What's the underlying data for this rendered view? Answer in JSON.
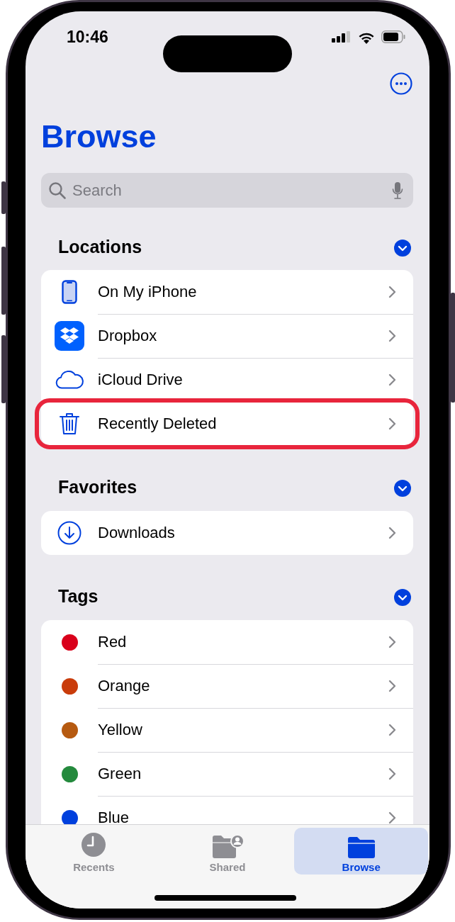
{
  "status_bar": {
    "time": "10:46"
  },
  "title": "Browse",
  "search": {
    "placeholder": "Search"
  },
  "sections": [
    {
      "title": "Locations",
      "expanded": true,
      "items": [
        {
          "kind": "phone",
          "label": "On My iPhone",
          "highlighted": false
        },
        {
          "kind": "dropbox",
          "label": "Dropbox",
          "highlighted": false
        },
        {
          "kind": "cloud",
          "label": "iCloud Drive",
          "highlighted": false
        },
        {
          "kind": "trash",
          "label": "Recently Deleted",
          "highlighted": true
        }
      ]
    },
    {
      "title": "Favorites",
      "expanded": true,
      "items": [
        {
          "kind": "download",
          "label": "Downloads",
          "highlighted": false
        }
      ]
    },
    {
      "title": "Tags",
      "expanded": true,
      "items": [
        {
          "kind": "tag",
          "label": "Red",
          "color": "#d9001b",
          "highlighted": false
        },
        {
          "kind": "tag",
          "label": "Orange",
          "color": "#c93c0b",
          "highlighted": false
        },
        {
          "kind": "tag",
          "label": "Yellow",
          "color": "#b65a10",
          "highlighted": false
        },
        {
          "kind": "tag",
          "label": "Green",
          "color": "#248a3d",
          "highlighted": false
        },
        {
          "kind": "tag",
          "label": "Blue",
          "color": "#0040dd",
          "highlighted": false
        }
      ]
    }
  ],
  "tabs": [
    {
      "kind": "recents",
      "label": "Recents",
      "selected": false
    },
    {
      "kind": "shared",
      "label": "Shared",
      "selected": false
    },
    {
      "kind": "browse",
      "label": "Browse",
      "selected": true
    }
  ]
}
